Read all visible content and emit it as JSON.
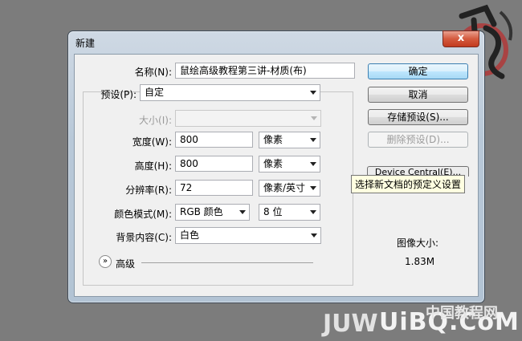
{
  "dialog": {
    "title": "新建",
    "close_label": "x"
  },
  "form": {
    "name": {
      "label": "名称(N):",
      "value": "鼠绘高级教程第三讲-材质(布)"
    },
    "preset": {
      "label": "预设(P):",
      "value": "自定"
    },
    "size": {
      "label": "大小(I):",
      "value": ""
    },
    "width": {
      "label": "宽度(W):",
      "value": "800",
      "unit": "像素"
    },
    "height": {
      "label": "高度(H):",
      "value": "800",
      "unit": "像素"
    },
    "resolution": {
      "label": "分辨率(R):",
      "value": "72",
      "unit": "像素/英寸"
    },
    "color_mode": {
      "label": "颜色模式(M):",
      "value": "RGB 颜色",
      "depth": "8 位"
    },
    "background": {
      "label": "背景内容(C):",
      "value": "白色"
    },
    "advanced": {
      "label": "高级"
    }
  },
  "buttons": {
    "ok": "确定",
    "cancel": "取消",
    "save_preset": "存储预设(S)...",
    "delete_preset": "删除预设(D)...",
    "device_central": "Device Central(E)..."
  },
  "tooltip": "选择新文档的预定义设置",
  "image_size": {
    "label": "图像大小:",
    "value": "1.83M"
  },
  "watermark": {
    "left": "JUW",
    "right": "UiBQ.CoM",
    "cn": "中国教程网"
  }
}
